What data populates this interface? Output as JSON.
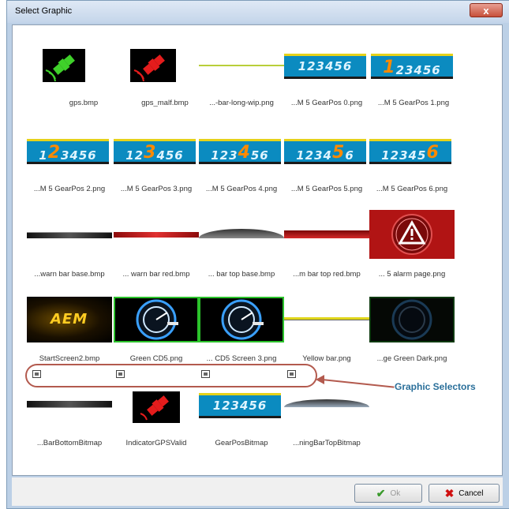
{
  "window": {
    "title": "Select Graphic",
    "close_label": "x"
  },
  "graphics": [
    {
      "label": "gps.bmp"
    },
    {
      "label": "gps_malf.bmp"
    },
    {
      "label": "...-bar-long-wip.png"
    },
    {
      "label": "...M 5 GearPos 0.png",
      "digits": "123456"
    },
    {
      "label": "...M 5 GearPos 1.png",
      "digits": "123456",
      "highlight": "1"
    },
    {
      "label": "...M 5 GearPos 2.png",
      "digits": "123456",
      "highlight": "2"
    },
    {
      "label": "...M 5 GearPos 3.png",
      "digits": "123456",
      "highlight": "3"
    },
    {
      "label": "...M 5 GearPos 4.png",
      "digits": "123456",
      "highlight": "4"
    },
    {
      "label": "...M 5 GearPos 5.png",
      "digits": "123456",
      "highlight": "5"
    },
    {
      "label": "...M 5 GearPos 6.png",
      "digits": "123456",
      "highlight": "6"
    },
    {
      "label": "...warn bar base.bmp"
    },
    {
      "label": "... warn bar red.bmp"
    },
    {
      "label": "... bar top base.bmp"
    },
    {
      "label": "...m bar top red.bmp"
    },
    {
      "label": "... 5 alarm page.png"
    },
    {
      "label": "StartScreen2.bmp",
      "logo_text": "AEM"
    },
    {
      "label": "Green CD5.png"
    },
    {
      "label": "... CD5 Screen 3.png"
    },
    {
      "label": "Yellow bar.png"
    },
    {
      "label": "...ge Green Dark.png"
    }
  ],
  "bitmaps": [
    {
      "label": "...BarBottomBitmap"
    },
    {
      "label": "IndicatorGPSValid"
    },
    {
      "label": "GearPosBitmap",
      "digits": "123456"
    },
    {
      "label": "...ningBarTopBitmap"
    }
  ],
  "annotation": {
    "text": "Graphic Selectors"
  },
  "footer": {
    "ok_label": "Ok",
    "cancel_label": "Cancel"
  }
}
